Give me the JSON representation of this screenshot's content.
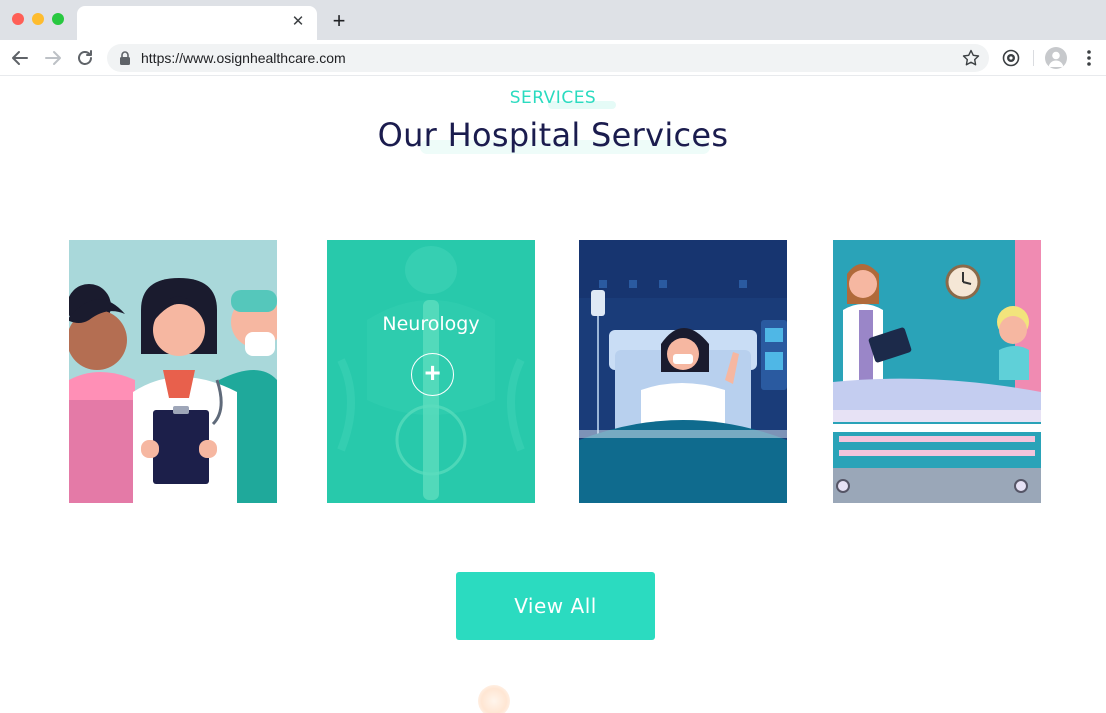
{
  "browser": {
    "url": "https://www.osignhealthcare.com",
    "tab_close": "✕",
    "new_tab": "+"
  },
  "section": {
    "eyebrow": "SERVICES",
    "title": "Our Hospital Services"
  },
  "cards": [
    {
      "illustration": "medical-staff-illustration"
    },
    {
      "title": "Neurology",
      "action": "+",
      "illustration": "neurology-xray-illustration"
    },
    {
      "illustration": "patient-in-bed-illustration"
    },
    {
      "illustration": "doctor-visiting-patient-illustration"
    }
  ],
  "cta": {
    "label": "View All"
  },
  "colors": {
    "accent": "#2bdbc0",
    "title": "#1b1c4e",
    "tab_strip": "#dee1e6"
  }
}
